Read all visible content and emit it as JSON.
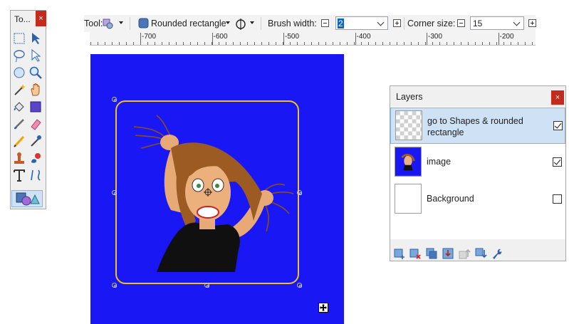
{
  "toolbar": {
    "tool_label": "Tool:",
    "shape_type": "Rounded rectangle",
    "brush_width_label": "Brush width:",
    "brush_width_value": "2",
    "corner_size_label": "Corner size:",
    "corner_size_value": "15"
  },
  "ruler": {
    "labels": [
      "-700",
      "-600",
      "-500",
      "-400",
      "-300",
      "-200"
    ]
  },
  "tools_window": {
    "title": "To...",
    "close": "×",
    "tools": [
      "rectangle-select-icon",
      "move-selection-icon",
      "lasso-select-icon",
      "move-selected-icon",
      "ellipse-select-icon",
      "zoom-icon",
      "magic-wand-icon",
      "pan-icon",
      "paint-bucket-icon",
      "gradient-icon",
      "paintbrush-icon",
      "eraser-icon",
      "pencil-icon",
      "color-picker-icon",
      "clone-stamp-icon",
      "recolor-icon",
      "text-icon",
      "line-curve-icon",
      "shapes-icon"
    ]
  },
  "layers_window": {
    "title": "Layers",
    "close": "×",
    "layers": [
      {
        "name": "go to Shapes & rounded rectangle",
        "visible": true,
        "selected": true
      },
      {
        "name": "image",
        "visible": true,
        "selected": false
      },
      {
        "name": "Background",
        "visible": false,
        "selected": false
      }
    ],
    "buttons": [
      "add-layer-icon",
      "delete-layer-icon",
      "duplicate-layer-icon",
      "merge-layer-down-icon",
      "move-layer-up-icon",
      "move-layer-down-icon",
      "layer-properties-icon"
    ]
  },
  "colors": {
    "canvas": "#1a17f5",
    "shape_outline": "#f0c21a",
    "close_button": "#c42b1c",
    "selection": "#cfe2f5"
  }
}
